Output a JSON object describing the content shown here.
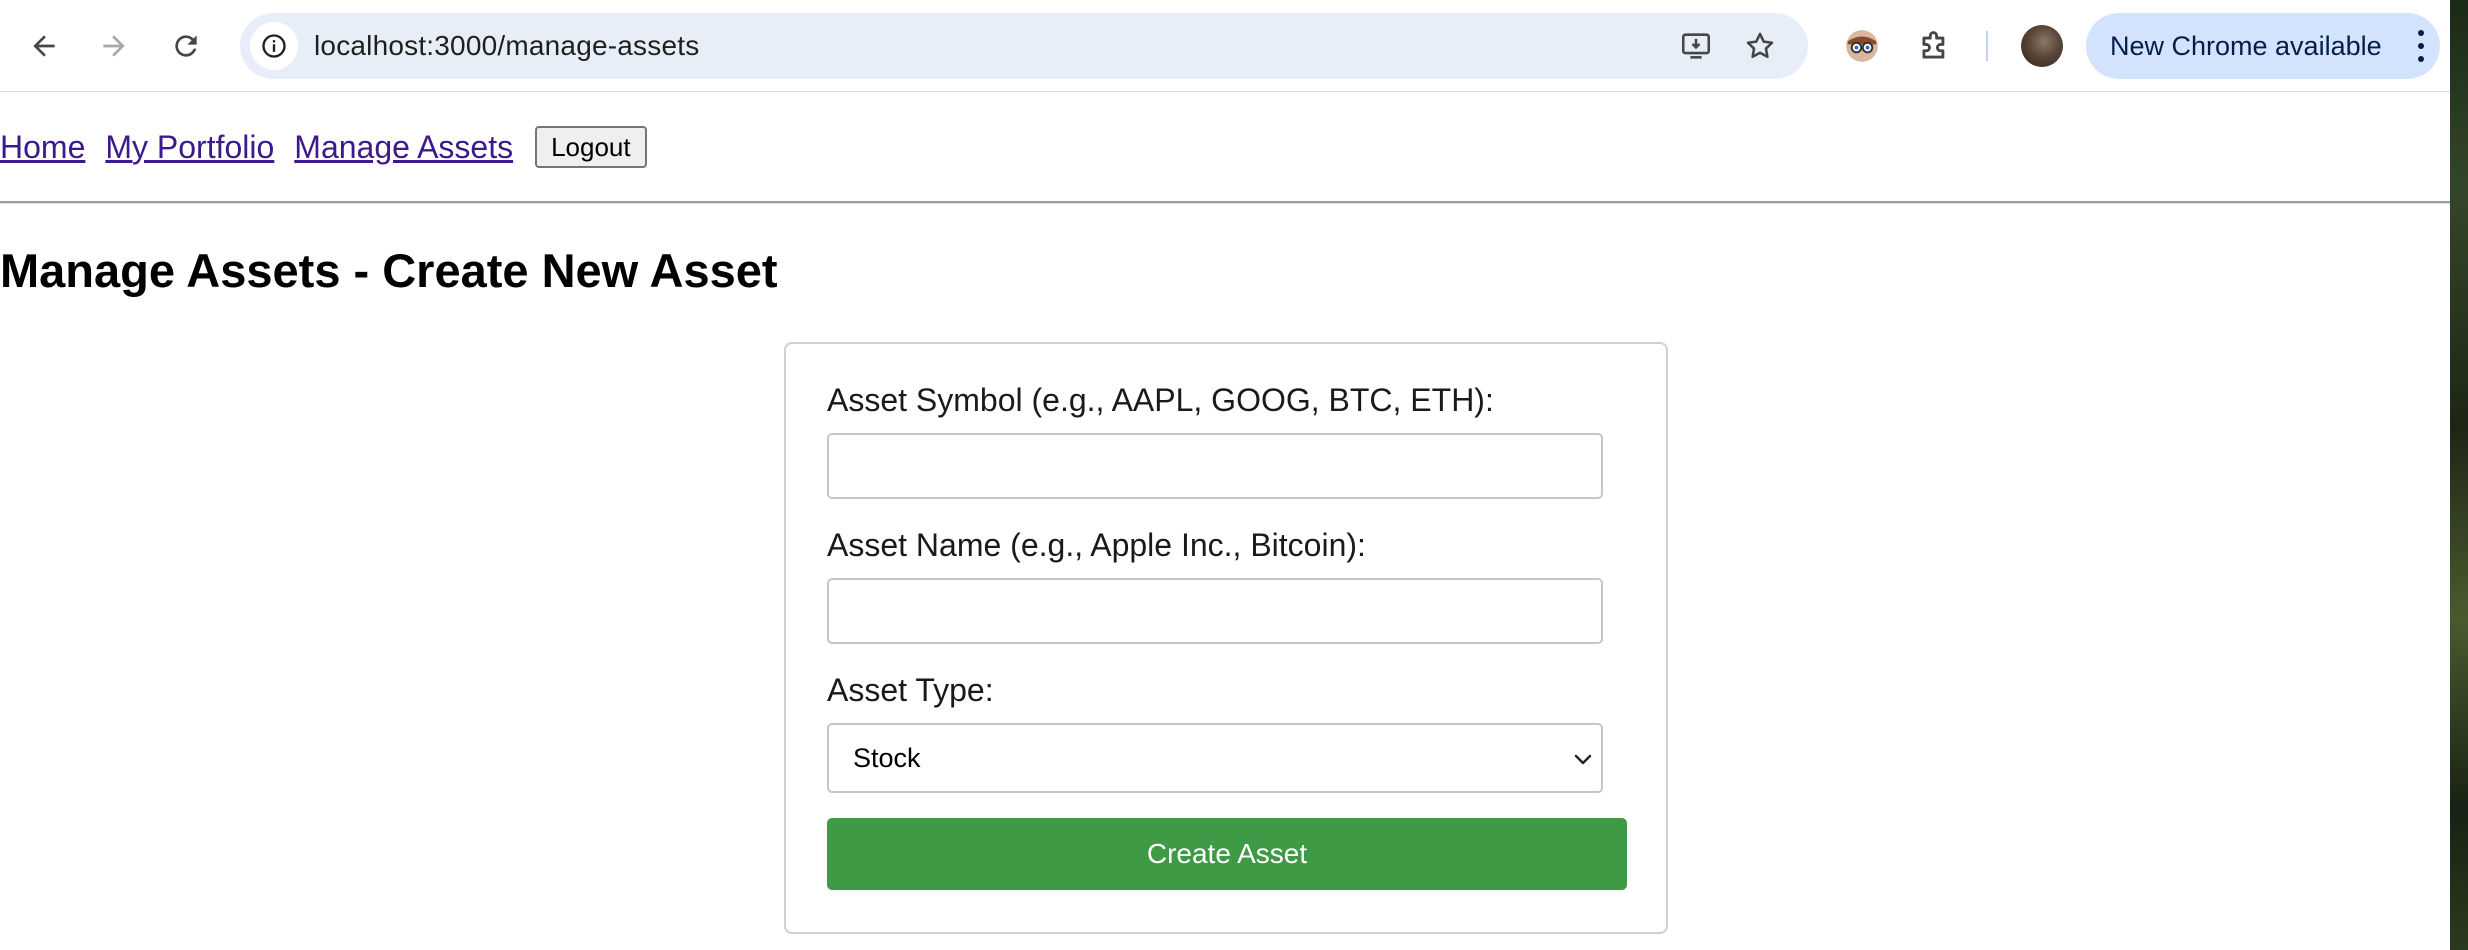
{
  "browser": {
    "url": "localhost:3000/manage-assets",
    "update_label": "New Chrome available",
    "icons": {
      "back": "arrow-left-icon",
      "forward": "arrow-right-icon",
      "reload": "reload-icon",
      "site_info": "info-icon",
      "install": "install-app-icon",
      "bookmark": "star-icon",
      "extension_face": "extension-avatar-icon",
      "extensions": "puzzle-icon",
      "profile": "profile-avatar",
      "menu": "kebab-menu-icon"
    }
  },
  "nav": {
    "links": [
      "Home",
      "My Portfolio",
      "Manage Assets"
    ],
    "logout_label": "Logout"
  },
  "page": {
    "title": "Manage Assets - Create New Asset"
  },
  "form": {
    "symbol_label": "Asset Symbol (e.g., AAPL, GOOG, BTC, ETH):",
    "symbol_value": "",
    "name_label": "Asset Name (e.g., Apple Inc., Bitcoin):",
    "name_value": "",
    "type_label": "Asset Type:",
    "type_selected": "Stock",
    "submit_label": "Create Asset"
  },
  "colors": {
    "link": "#3c1a8c",
    "submit_bg": "#3e9a45",
    "omnibox_bg": "#e8eef8",
    "update_pill_bg": "#d3e3fd"
  }
}
